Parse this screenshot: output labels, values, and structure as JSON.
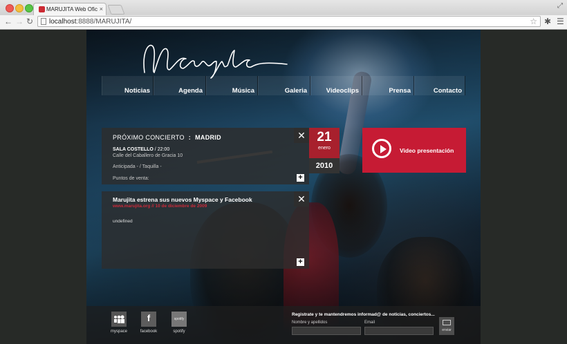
{
  "browser": {
    "tab_title": "MARUJITA Web Oficial | In",
    "tab_close": "×",
    "url_host": "localhost",
    "url_rest": ":8888/MARUJITA/"
  },
  "site": {
    "logo_text": "Marujita",
    "nav": [
      "Noticias",
      "Agenda",
      "Música",
      "Galeria",
      "Videoclips",
      "Prensa",
      "Contacto"
    ],
    "concert": {
      "title": "PRÓXIMO CONCIERTO",
      "separator": ":",
      "city": "MADRID",
      "venue": "SALA COSTELLO",
      "time": " / 22:00",
      "address": "Calle del Caballero de Gracia 10",
      "tickets": "Anticipada -   / Taquilla -",
      "points": "Puntos de venta:",
      "day": "21",
      "month": "enero",
      "year": "2010",
      "close": "✕",
      "plus": "+"
    },
    "news": {
      "title": "Marujita estrena sus nuevos Myspace y Facebook",
      "meta": "www.marujita.org // 10 de diciembre de 2009",
      "body": "undefined",
      "close": "✕",
      "plus": "+"
    },
    "video": {
      "label": "Video presentación"
    },
    "footer": {
      "social": [
        {
          "label": "myspace",
          "icon": "myspace-icon"
        },
        {
          "label": "facebook",
          "icon": "facebook-icon",
          "glyph": "f"
        },
        {
          "label": "spotify",
          "icon": "spotify-icon",
          "glyph": "spotify"
        }
      ],
      "newsletter_text": "Registrate y te mantendremos informad@ de noticias, conciertos...",
      "name_label": "Nombre y apellidos",
      "email_label": "Email",
      "send_label": "enviar"
    }
  }
}
